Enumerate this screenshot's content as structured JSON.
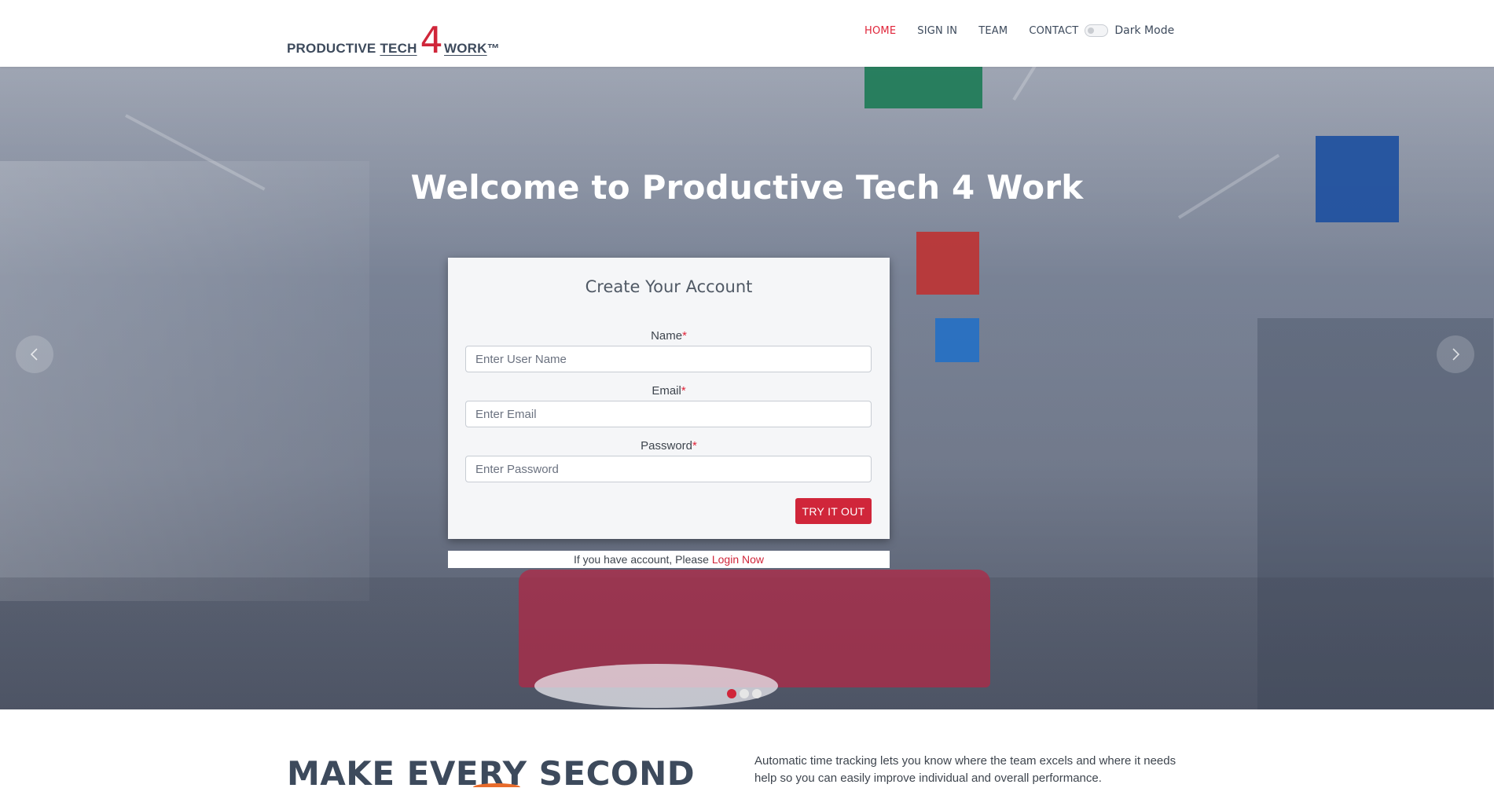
{
  "brand": {
    "part1": "PRODUCTIVE",
    "part2": "TECH",
    "four": "4",
    "part3": "WORK",
    "trademark": "™"
  },
  "nav": {
    "items": [
      {
        "label": "HOME",
        "active": true
      },
      {
        "label": "SIGN IN",
        "active": false
      },
      {
        "label": "TEAM",
        "active": false
      },
      {
        "label": "CONTACT",
        "active": false
      }
    ],
    "dark_mode_label": "Dark Mode",
    "dark_mode_on": false
  },
  "hero": {
    "title": "Welcome to Productive Tech 4 Work",
    "slide_count": 3,
    "active_slide": 1
  },
  "signup": {
    "title": "Create Your Account",
    "required_mark": "*",
    "name_label": "Name",
    "name_placeholder": "Enter User Name",
    "email_label": "Email",
    "email_placeholder": "Enter Email",
    "password_label": "Password",
    "password_placeholder": "Enter Password",
    "submit_label": "TRY IT OUT"
  },
  "login_prompt": {
    "text": "If you have account, Please",
    "link": "Login Now"
  },
  "section": {
    "heading": "MAKE EVERY SECOND",
    "body": "Automatic time tracking lets you know where the team excels and where it needs help so you can easily improve individual and overall performance."
  },
  "colors": {
    "accent": "#d0263a",
    "text_dark": "#3d4a5c"
  }
}
